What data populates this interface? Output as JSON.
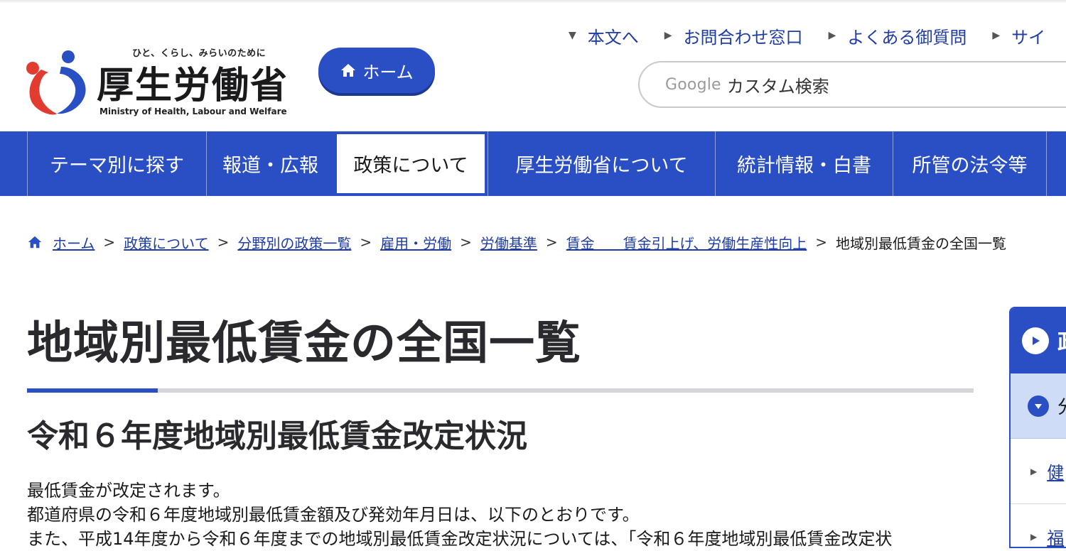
{
  "header": {
    "tagline": "ひと、くらし、みらいのために",
    "org_name": "厚生労働省",
    "org_name_en": "Ministry of Health, Labour and Welfare",
    "home_button": "ホーム",
    "util_links": [
      "本文へ",
      "お問合わせ窓口",
      "よくある御質問",
      "サイ"
    ],
    "search_brand": "Google",
    "search_placeholder": "カスタム検索"
  },
  "gnav": {
    "items": [
      "テーマ別に探す",
      "報道・広報",
      "政策について",
      "厚生労働省について",
      "統計情報・白書",
      "所管の法令等"
    ]
  },
  "breadcrumb": {
    "items": [
      "ホーム",
      "政策について",
      "分野別の政策一覧",
      "雇用・労働",
      "労働基準",
      "賃金　　賃金引上げ、労働生産性向上"
    ],
    "current": "地域別最低賃金の全国一覧",
    "separator": ">"
  },
  "main": {
    "title": "地域別最低賃金の全国一覧",
    "section_title": "令和６年度地域別最低賃金改定状況",
    "paragraphs": [
      "最低賃金が改定されます。",
      "都道府県の令和６年度地域別最低賃金額及び発効年月日は、以下のとおりです。",
      "また、平成14年度から令和６年度までの地域別最低賃金改定状況については、「令和６年度地域別最低賃金改定状"
    ]
  },
  "side": {
    "head": "政",
    "sub": "分",
    "items": [
      "健",
      "福"
    ]
  },
  "colors": {
    "primary": "#2a4fc4",
    "link": "#1f3da3",
    "sub_bg": "#cfdcf8"
  }
}
